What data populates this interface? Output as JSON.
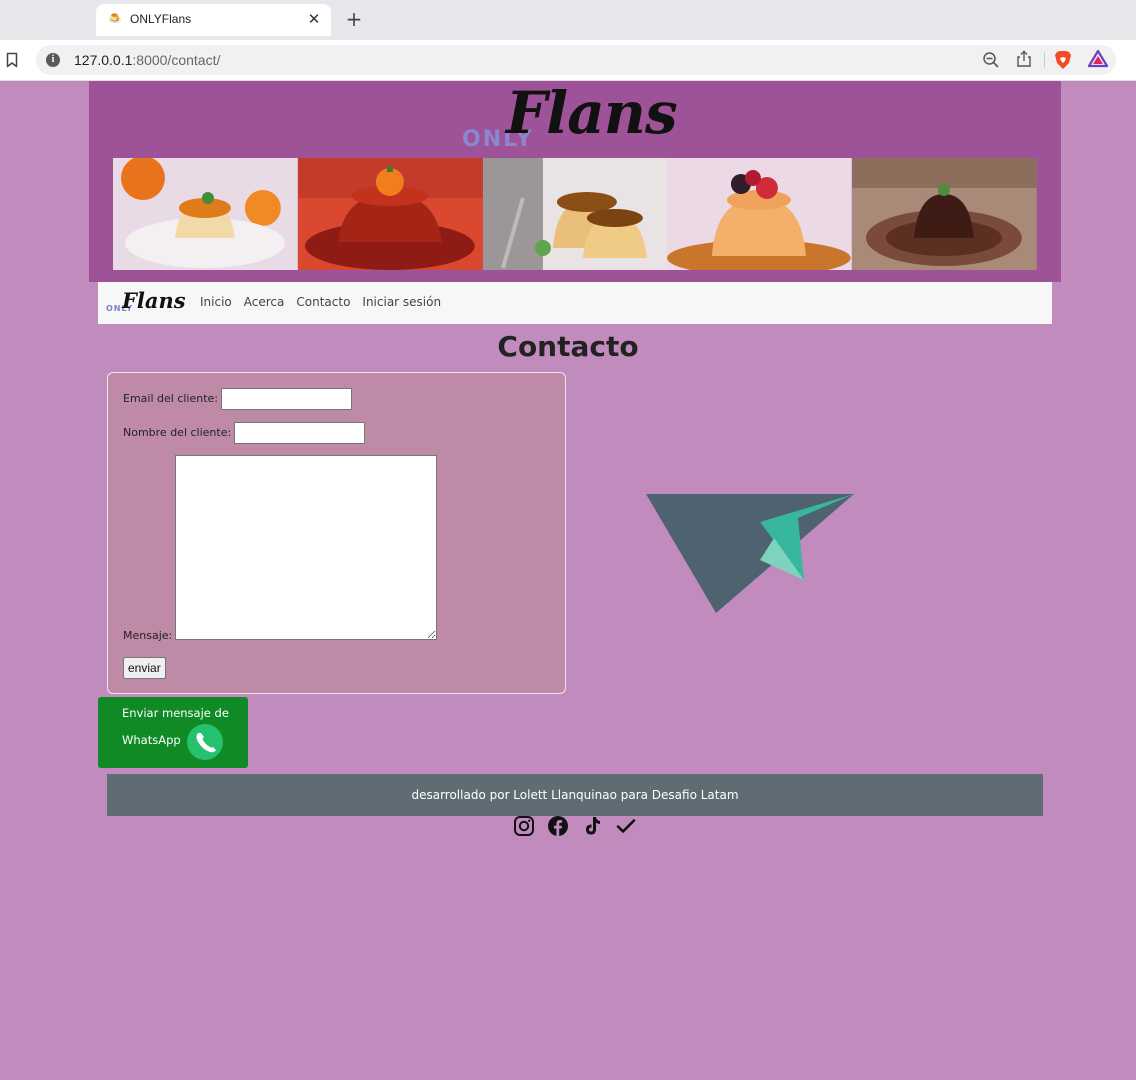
{
  "browser": {
    "tab_title": "ONLYFlans",
    "favicon": "🍮",
    "close_glyph": "✕",
    "new_tab_glyph": "+",
    "url_host": "127.0.0.1",
    "url_path": ":8000/contact/"
  },
  "brand": {
    "only": "ONLY",
    "flans": "Flans"
  },
  "nav": {
    "items": [
      {
        "label": "Inicio"
      },
      {
        "label": "Acerca"
      },
      {
        "label": "Contacto"
      },
      {
        "label": "Iniciar sesión"
      }
    ]
  },
  "page": {
    "title": "Contacto"
  },
  "form": {
    "email_label": "Email del cliente:",
    "email_value": "",
    "name_label": "Nombre del cliente:",
    "name_value": "",
    "message_label": "Mensaje:",
    "message_value": "",
    "submit_label": "enviar"
  },
  "whatsapp": {
    "line1": "Enviar mensaje de",
    "line2": "WhatsApp"
  },
  "footer": {
    "text": "desarrollado por Lolett Llanquinao para Desafio Latam"
  },
  "socials": [
    "instagram-icon",
    "facebook-icon",
    "tiktok-icon",
    "check-icon"
  ],
  "colors": {
    "page_bg": "#c18bbe",
    "banner_bg": "#9e5398",
    "form_bg": "#bf8aa8",
    "whatsapp_green": "#0f8a25",
    "footer_bg": "#5f6c73",
    "plane_dark": "#4f6270",
    "plane_teal": "#37b89c"
  }
}
